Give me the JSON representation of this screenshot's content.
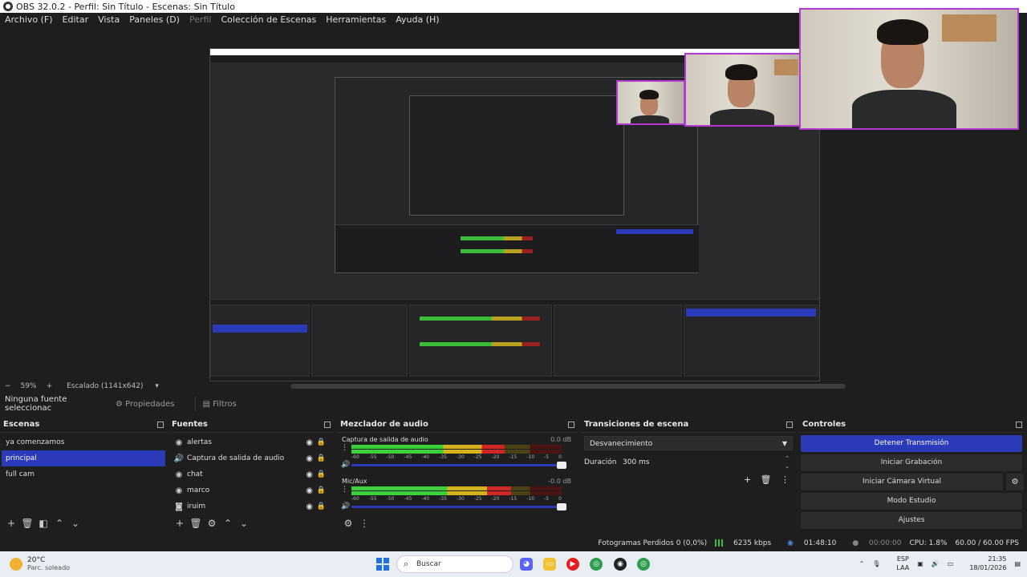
{
  "window": {
    "title": "OBS 32.0.2 - Perfil: Sin Título - Escenas: Sin Título"
  },
  "menu": {
    "items": [
      "Archivo (F)",
      "Editar",
      "Vista",
      "Paneles (D)",
      "Perfil",
      "Colección de Escenas",
      "Herramientas",
      "Ayuda (H)"
    ]
  },
  "preview": {
    "zoom": "59%",
    "zoom_minus": "−",
    "zoom_plus": "+",
    "scale_label": "Escalado (1141x642)"
  },
  "source_toolbar": {
    "no_source": "Ninguna fuente seleccionac",
    "properties": "Propiedades",
    "filters": "Filtros"
  },
  "scenes": {
    "title": "Escenas",
    "items": [
      "ya comenzamos",
      "principal",
      "full cam"
    ],
    "selected_index": 1
  },
  "sources": {
    "title": "Fuentes",
    "items": [
      {
        "name": "alertas",
        "icon": "globe-icon"
      },
      {
        "name": "Captura de salida de audio",
        "icon": "speaker-icon"
      },
      {
        "name": "chat",
        "icon": "globe-icon"
      },
      {
        "name": "marco",
        "icon": "globe-icon"
      },
      {
        "name": "iruim",
        "icon": "camera-icon"
      }
    ]
  },
  "mixer": {
    "title": "Mezclador de audio",
    "tracks": [
      {
        "name": "Captura de salida de audio",
        "db": "0.0 dB",
        "level": 0.73
      },
      {
        "name": "Mic/Aux",
        "db": "-0.0 dB",
        "level": 0.76
      }
    ],
    "ticks": [
      "-60",
      "-55",
      "-50",
      "-45",
      "-40",
      "-35",
      "-30",
      "-25",
      "-20",
      "-15",
      "-10",
      "-5",
      "0"
    ]
  },
  "transitions": {
    "title": "Transiciones de escena",
    "selected": "Desvanecimiento",
    "duration_label": "Duración",
    "duration_value": "300 ms"
  },
  "controls": {
    "title": "Controles",
    "stop_stream": "Detener Transmisión",
    "start_recording": "Iniciar Grabación",
    "start_virtual_cam": "Iniciar Cámara Virtual",
    "studio_mode": "Modo Estudio",
    "settings": "Ajustes"
  },
  "status": {
    "dropped_frames": "Fotogramas Perdidos 0 (0,0%)",
    "bitrate": "6235 kbps",
    "stream_time": "01:48:10",
    "rec_time": "00:00:00",
    "cpu": "CPU: 1.8%",
    "fps": "60.00 / 60.00 FPS"
  },
  "taskbar": {
    "temp": "20°C",
    "weather": "Parc. soleado",
    "search_placeholder": "Buscar",
    "lang1": "ESP",
    "lang2": "LAA",
    "time": "21:35",
    "date": "18/01/2026"
  },
  "colors": {
    "accent": "#2a3ab8",
    "cam_border": "#b23ad1",
    "meter_green": "#3cd13c",
    "meter_yellow": "#d4b21e",
    "meter_red": "#d12626"
  }
}
